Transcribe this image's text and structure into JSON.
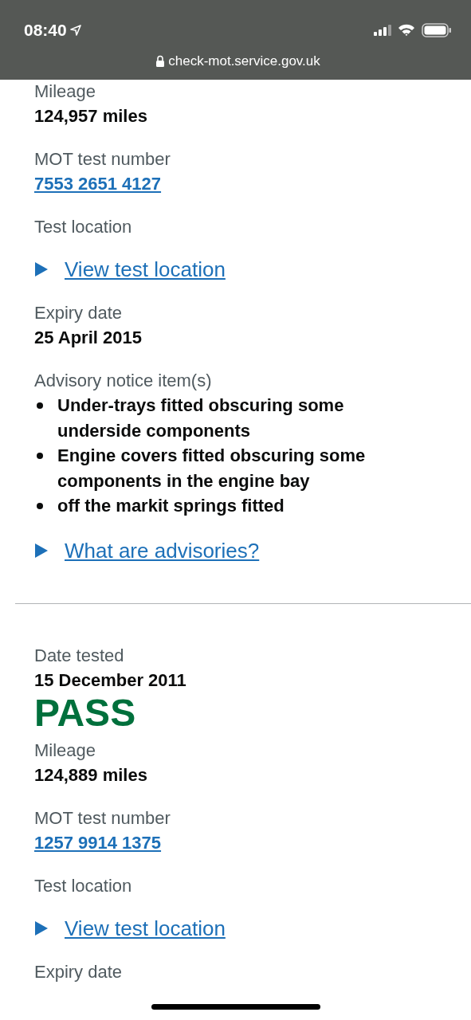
{
  "browser": {
    "time": "08:40",
    "url": "check-mot.service.gov.uk"
  },
  "tests": [
    {
      "fields": [
        {
          "kind": "text",
          "label": "Mileage",
          "value": "124,957 miles"
        },
        {
          "kind": "link",
          "label": "MOT test number",
          "value": "7553 2651 4127"
        },
        {
          "kind": "details",
          "label": "Test location",
          "summary": "View test location",
          "expanded": false
        },
        {
          "kind": "text",
          "label": "Expiry date",
          "value": "25 April 2015"
        },
        {
          "kind": "list",
          "label": "Advisory notice item(s)",
          "items": [
            "Under-trays fitted obscuring some underside components",
            "Engine covers fitted obscuring some components in the engine bay",
            "off the markit springs fitted"
          ]
        },
        {
          "kind": "details",
          "summary": "What are advisories?",
          "expanded": false
        }
      ]
    },
    {
      "date_label": "Date tested",
      "date": "15 December 2011",
      "result": "PASS",
      "passed": true,
      "fields": [
        {
          "kind": "text",
          "label": "Mileage",
          "value": "124,889 miles"
        },
        {
          "kind": "link",
          "label": "MOT test number",
          "value": "1257 9914 1375"
        },
        {
          "kind": "details",
          "label": "Test location",
          "summary": "View test location",
          "expanded": false
        },
        {
          "kind": "label",
          "label": "Expiry date"
        }
      ]
    }
  ]
}
